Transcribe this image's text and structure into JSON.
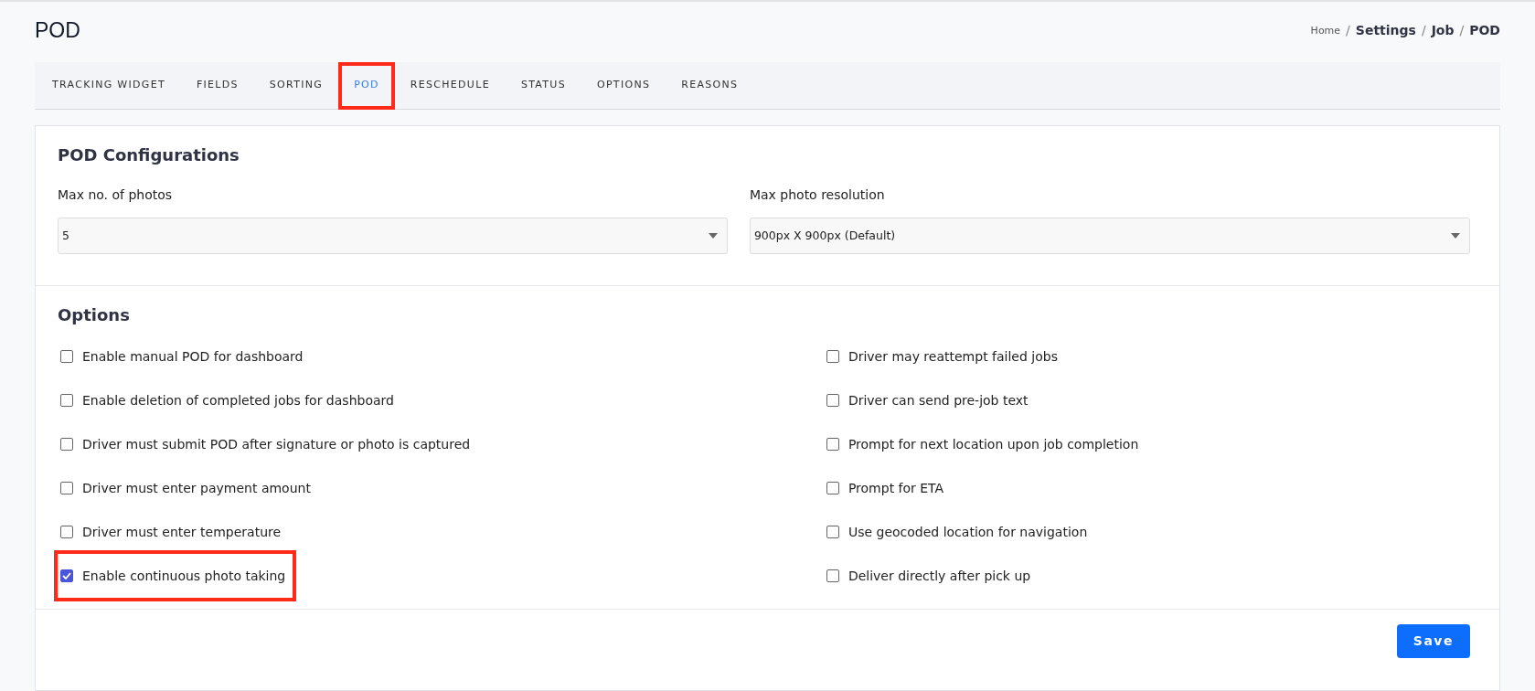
{
  "page_title": "POD",
  "breadcrumb_separator": "/",
  "breadcrumb": [
    {
      "label": "Home",
      "current": false
    },
    {
      "label": "Settings",
      "current": true
    },
    {
      "label": "Job",
      "current": true
    },
    {
      "label": "POD",
      "current": true
    }
  ],
  "tabs": [
    {
      "label": "TRACKING WIDGET",
      "selected": false,
      "highlighted": false
    },
    {
      "label": "FIELDS",
      "selected": false,
      "highlighted": false
    },
    {
      "label": "SORTING",
      "selected": false,
      "highlighted": false
    },
    {
      "label": "POD",
      "selected": true,
      "highlighted": true
    },
    {
      "label": "RESCHEDULE",
      "selected": false,
      "highlighted": false
    },
    {
      "label": "STATUS",
      "selected": false,
      "highlighted": false
    },
    {
      "label": "OPTIONS",
      "selected": false,
      "highlighted": false
    },
    {
      "label": "REASONS",
      "selected": false,
      "highlighted": false
    }
  ],
  "configurations": {
    "title": "POD Configurations",
    "fields": [
      {
        "label": "Max no. of photos",
        "value": "5"
      },
      {
        "label": "Max photo resolution",
        "value": "900px X 900px (Default)"
      }
    ]
  },
  "options": {
    "title": "Options",
    "columns": [
      [
        {
          "label": "Enable manual POD for dashboard",
          "checked": false,
          "highlighted": false
        },
        {
          "label": "Enable deletion of completed jobs for dashboard",
          "checked": false,
          "highlighted": false
        },
        {
          "label": "Driver must submit POD after signature or photo is captured",
          "checked": false,
          "highlighted": false
        },
        {
          "label": "Driver must enter payment amount",
          "checked": false,
          "highlighted": false
        },
        {
          "label": "Driver must enter temperature",
          "checked": false,
          "highlighted": false
        },
        {
          "label": "Enable continuous photo taking",
          "checked": true,
          "highlighted": true
        }
      ],
      [
        {
          "label": "Driver may reattempt failed jobs",
          "checked": false,
          "highlighted": false
        },
        {
          "label": "Driver can send pre-job text",
          "checked": false,
          "highlighted": false
        },
        {
          "label": "Prompt for next location upon job completion",
          "checked": false,
          "highlighted": false
        },
        {
          "label": "Prompt for ETA",
          "checked": false,
          "highlighted": false
        },
        {
          "label": "Use geocoded location for navigation",
          "checked": false,
          "highlighted": false
        },
        {
          "label": "Deliver directly after pick up",
          "checked": false,
          "highlighted": false
        }
      ]
    ]
  },
  "save_button": "Save"
}
